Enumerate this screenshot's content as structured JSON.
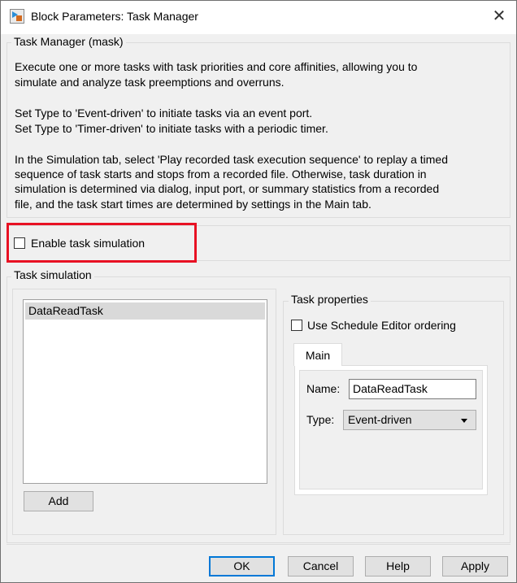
{
  "window": {
    "title": "Block Parameters: Task Manager",
    "close_icon": "close-icon"
  },
  "mask": {
    "legend": "Task Manager (mask)",
    "lines": [
      "Execute one or more tasks with task priorities and core affinities, allowing you to",
      "simulate and analyze task preemptions and overruns.",
      "Set Type to 'Event-driven' to initiate tasks via an event port.",
      "Set Type to 'Timer-driven' to initiate tasks with a periodic timer.",
      "In the Simulation tab, select 'Play recorded task execution sequence' to replay a timed",
      "sequence of task starts and stops from a recorded file. Otherwise, task duration in",
      "simulation is determined via dialog, input port, or summary statistics from a recorded",
      "file, and the task start times are determined by settings in the Main tab."
    ]
  },
  "enable": {
    "label": "Enable task simulation",
    "checked": false,
    "highlight_color": "#e81123"
  },
  "task_sim": {
    "legend": "Task simulation",
    "tasks": [
      "DataReadTask"
    ],
    "add_label": "Add"
  },
  "props": {
    "legend": "Task properties",
    "schedule_label": "Use Schedule Editor ordering",
    "schedule_checked": false,
    "tab": "Main",
    "name_label": "Name:",
    "name_value": "DataReadTask",
    "type_label": "Type:",
    "type_value": "Event-driven"
  },
  "buttons": {
    "ok": "OK",
    "cancel": "Cancel",
    "help": "Help",
    "apply": "Apply"
  }
}
